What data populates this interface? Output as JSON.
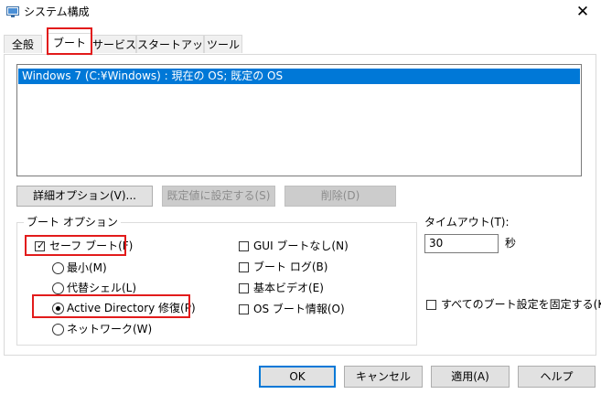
{
  "window": {
    "title": "システム構成",
    "close_glyph": "✕"
  },
  "tabs": [
    {
      "label": "全般"
    },
    {
      "label": "ブート"
    },
    {
      "label": "サービス"
    },
    {
      "label": "スタートアップ"
    },
    {
      "label": "ツール"
    }
  ],
  "os_list": {
    "items": [
      "Windows 7 (C:¥Windows) : 現在の OS; 既定の OS"
    ]
  },
  "list_buttons": {
    "advanced": "詳細オプション(V)...",
    "set_default": "既定値に設定する(S)",
    "delete": "削除(D)"
  },
  "boot_options": {
    "title": "ブート オプション",
    "safe_boot": {
      "label": "セーフ ブート(F)",
      "checked": true
    },
    "safe_modes": [
      {
        "label": "最小(M)",
        "selected": false
      },
      {
        "label": "代替シェル(L)",
        "selected": false
      },
      {
        "label": "Active Directory 修復(P)",
        "selected": true
      },
      {
        "label": "ネットワーク(W)",
        "selected": false
      }
    ],
    "right_options": [
      {
        "label": "GUI ブートなし(N)",
        "checked": false
      },
      {
        "label": "ブート ログ(B)",
        "checked": false
      },
      {
        "label": "基本ビデオ(E)",
        "checked": false
      },
      {
        "label": "OS ブート情報(O)",
        "checked": false
      }
    ]
  },
  "timeout": {
    "label": "タイムアウト(T):",
    "value": "30",
    "unit": "秒"
  },
  "permanent": {
    "label": "すべてのブート設定を固定する(K)",
    "checked": false
  },
  "dialog_buttons": {
    "ok": "OK",
    "cancel": "キャンセル",
    "apply": "適用(A)",
    "help": "ヘルプ"
  },
  "colors": {
    "highlight_red": "#e21b1b",
    "selection_blue": "#0078d7"
  }
}
